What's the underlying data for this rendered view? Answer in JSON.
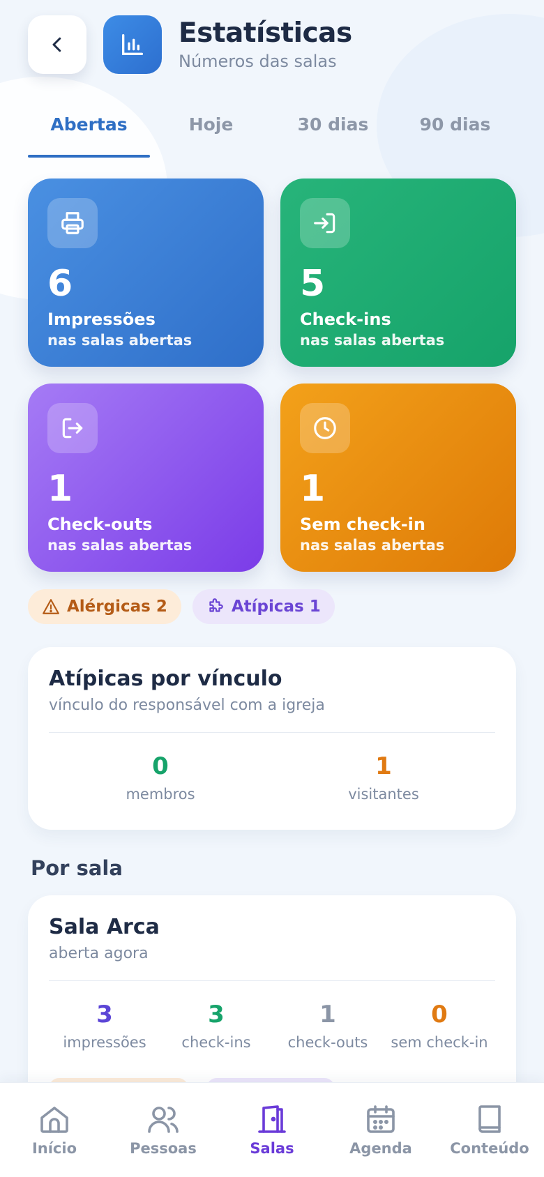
{
  "header": {
    "title": "Estatísticas",
    "subtitle": "Números das salas",
    "back_icon": "chevron-left-icon",
    "app_icon": "bar-chart-icon"
  },
  "tabs": [
    {
      "label": "Abertas",
      "active": true
    },
    {
      "label": "Hoje",
      "active": false
    },
    {
      "label": "30 dias",
      "active": false
    },
    {
      "label": "90 dias",
      "active": false
    }
  ],
  "stats": [
    {
      "value": "6",
      "label": "Impressões",
      "sub": "nas salas abertas",
      "icon": "printer-icon",
      "color": "#3a80da"
    },
    {
      "value": "5",
      "label": "Check-ins",
      "sub": "nas salas abertas",
      "icon": "login-icon",
      "color": "#1fae72"
    },
    {
      "value": "1",
      "label": "Check-outs",
      "sub": "nas salas abertas",
      "icon": "logout-icon",
      "color": "#8e5bee"
    },
    {
      "value": "1",
      "label": "Sem check-in",
      "sub": "nas salas abertas",
      "icon": "clock-icon",
      "color": "#ea8c0f"
    }
  ],
  "chips": {
    "allergic": "Alérgicas 2",
    "atypical": "Atípicas 1"
  },
  "atypical_panel": {
    "title": "Atípicas por vínculo",
    "subtitle": "vínculo do responsável com a igreja",
    "members_value": "0",
    "members_label": "membros",
    "visitors_value": "1",
    "visitors_label": "visitantes"
  },
  "section_title": "Por sala",
  "room": {
    "name": "Sala Arca",
    "status": "aberta agora",
    "stats": [
      {
        "value": "3",
        "label": "impressões",
        "color": "#5b45d6"
      },
      {
        "value": "3",
        "label": "check-ins",
        "color": "#16a36a"
      },
      {
        "value": "1",
        "label": "check-outs",
        "color": "#8b95a6"
      },
      {
        "value": "0",
        "label": "sem check-in",
        "color": "#e07a12"
      }
    ]
  },
  "nav": [
    {
      "label": "Início",
      "icon": "home-icon",
      "active": false
    },
    {
      "label": "Pessoas",
      "icon": "people-icon",
      "active": false
    },
    {
      "label": "Salas",
      "icon": "door-icon",
      "active": true
    },
    {
      "label": "Agenda",
      "icon": "calendar-icon",
      "active": false
    },
    {
      "label": "Conteúdo",
      "icon": "book-icon",
      "active": false
    }
  ]
}
